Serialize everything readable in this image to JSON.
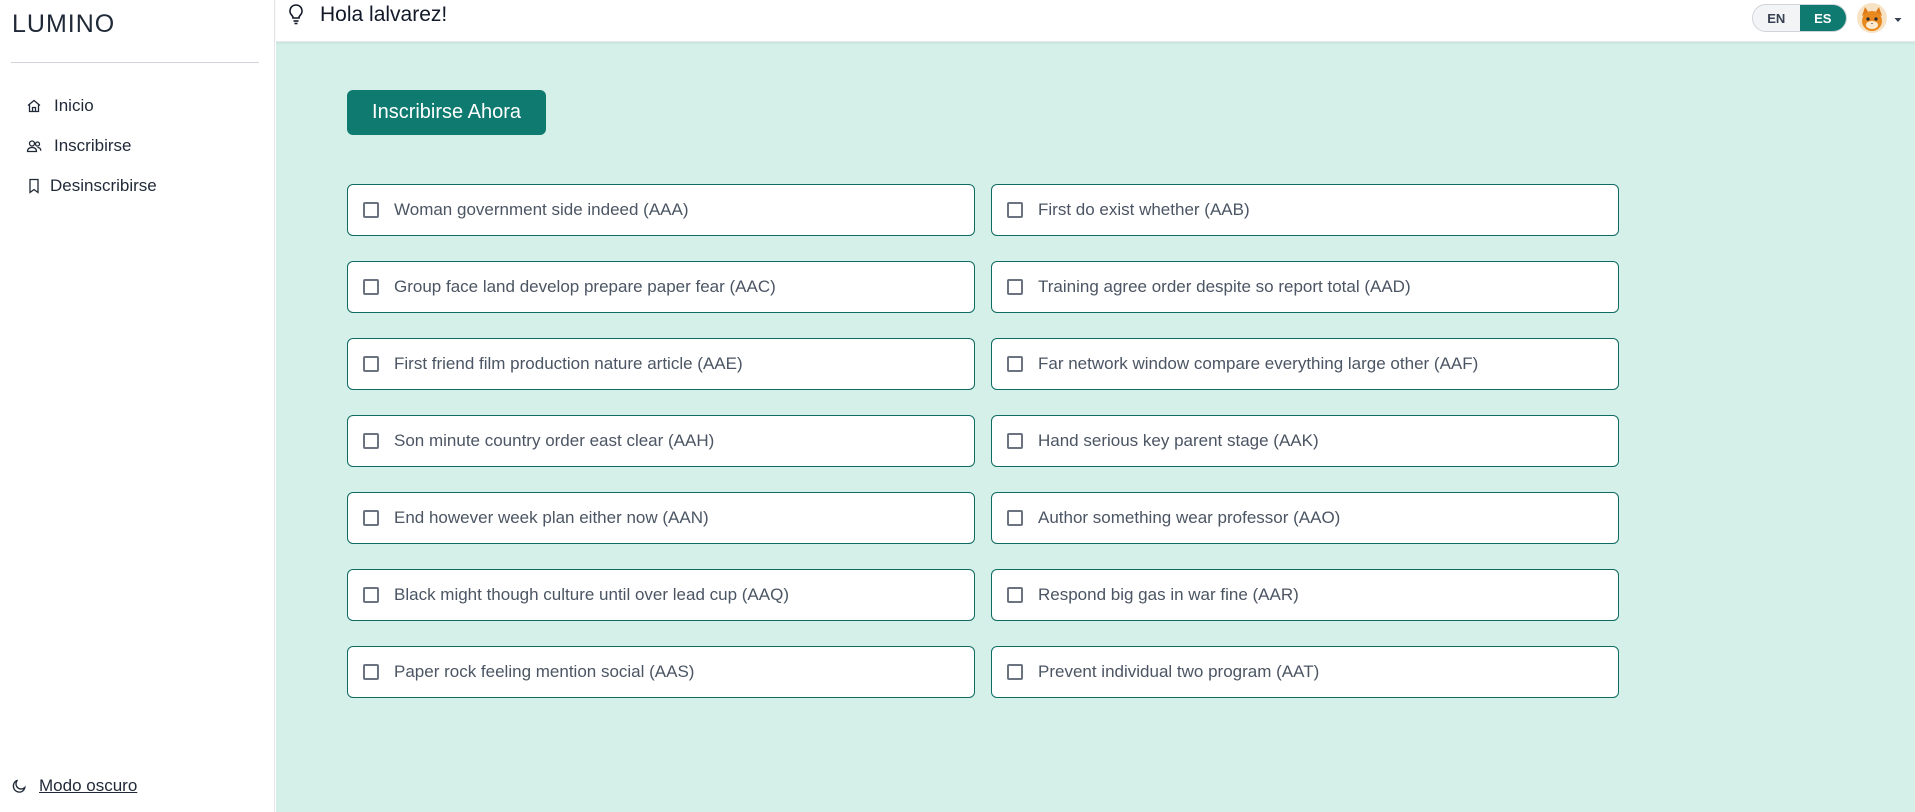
{
  "app": {
    "brand": "LUMINO"
  },
  "sidebar": {
    "items": [
      {
        "label": "Inicio",
        "icon": "home-icon"
      },
      {
        "label": "Inscribirse",
        "icon": "users-icon"
      },
      {
        "label": "Desinscribirse",
        "icon": "bookmark-icon"
      }
    ],
    "dark_mode_label": "Modo oscuro"
  },
  "header": {
    "greeting": "Hola lalvarez!",
    "languages": [
      "EN",
      "ES"
    ],
    "active_language": "ES"
  },
  "main": {
    "enroll_button": "Inscribirse Ahora",
    "courses": [
      {
        "label": "Woman government side indeed (AAA)",
        "checked": false
      },
      {
        "label": "First do exist whether (AAB)",
        "checked": false
      },
      {
        "label": "Group face land develop prepare paper fear (AAC)",
        "checked": false
      },
      {
        "label": "Training agree order despite so report total (AAD)",
        "checked": false
      },
      {
        "label": "First friend film production nature article (AAE)",
        "checked": false
      },
      {
        "label": "Far network window compare everything large other (AAF)",
        "checked": false
      },
      {
        "label": "Son minute country order east clear (AAH)",
        "checked": false
      },
      {
        "label": "Hand serious key parent stage (AAK)",
        "checked": false
      },
      {
        "label": "End however week plan either now (AAN)",
        "checked": false
      },
      {
        "label": "Author something wear professor (AAO)",
        "checked": false
      },
      {
        "label": "Black might though culture until over lead cup (AAQ)",
        "checked": false
      },
      {
        "label": "Respond big gas in war fine (AAR)",
        "checked": false
      },
      {
        "label": "Paper rock feeling mention social (AAS)",
        "checked": false
      },
      {
        "label": "Prevent individual two program (AAT)",
        "checked": false
      }
    ]
  },
  "colors": {
    "accent": "#0f7a70",
    "main_background": "#d4f0e8",
    "card_border": "#0f6b62"
  }
}
